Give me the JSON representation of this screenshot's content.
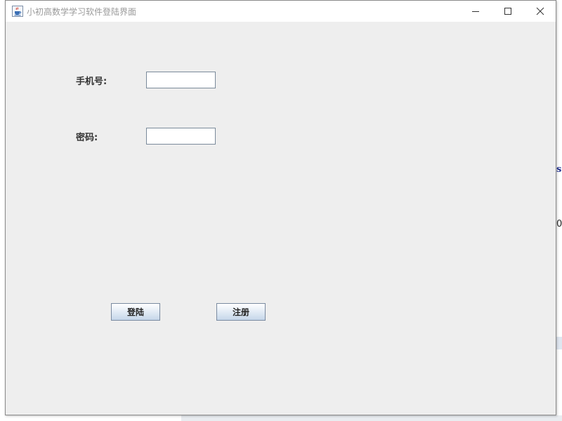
{
  "window": {
    "title": "小初高数学学习软件登陆界面",
    "controls": {
      "minimize_icon": "minimize-icon",
      "maximize_icon": "maximize-icon",
      "close_icon": "close-icon"
    },
    "app_icon": "java-coffee-cup-icon"
  },
  "form": {
    "phone_label": "手机号:",
    "phone_value": "",
    "password_label": "密码:",
    "password_value": ""
  },
  "buttons": {
    "login_label": "登陆",
    "register_label": "注册"
  },
  "background": {
    "partial_text_1": "s",
    "partial_text_2": "0"
  },
  "colors": {
    "window_bg": "#eeeeee",
    "titlebar_bg": "#ffffff",
    "title_text": "#999999",
    "button_gradient_top": "#ffffff",
    "button_gradient_bottom": "#c5d6ea",
    "field_border": "#7a8a9a"
  }
}
